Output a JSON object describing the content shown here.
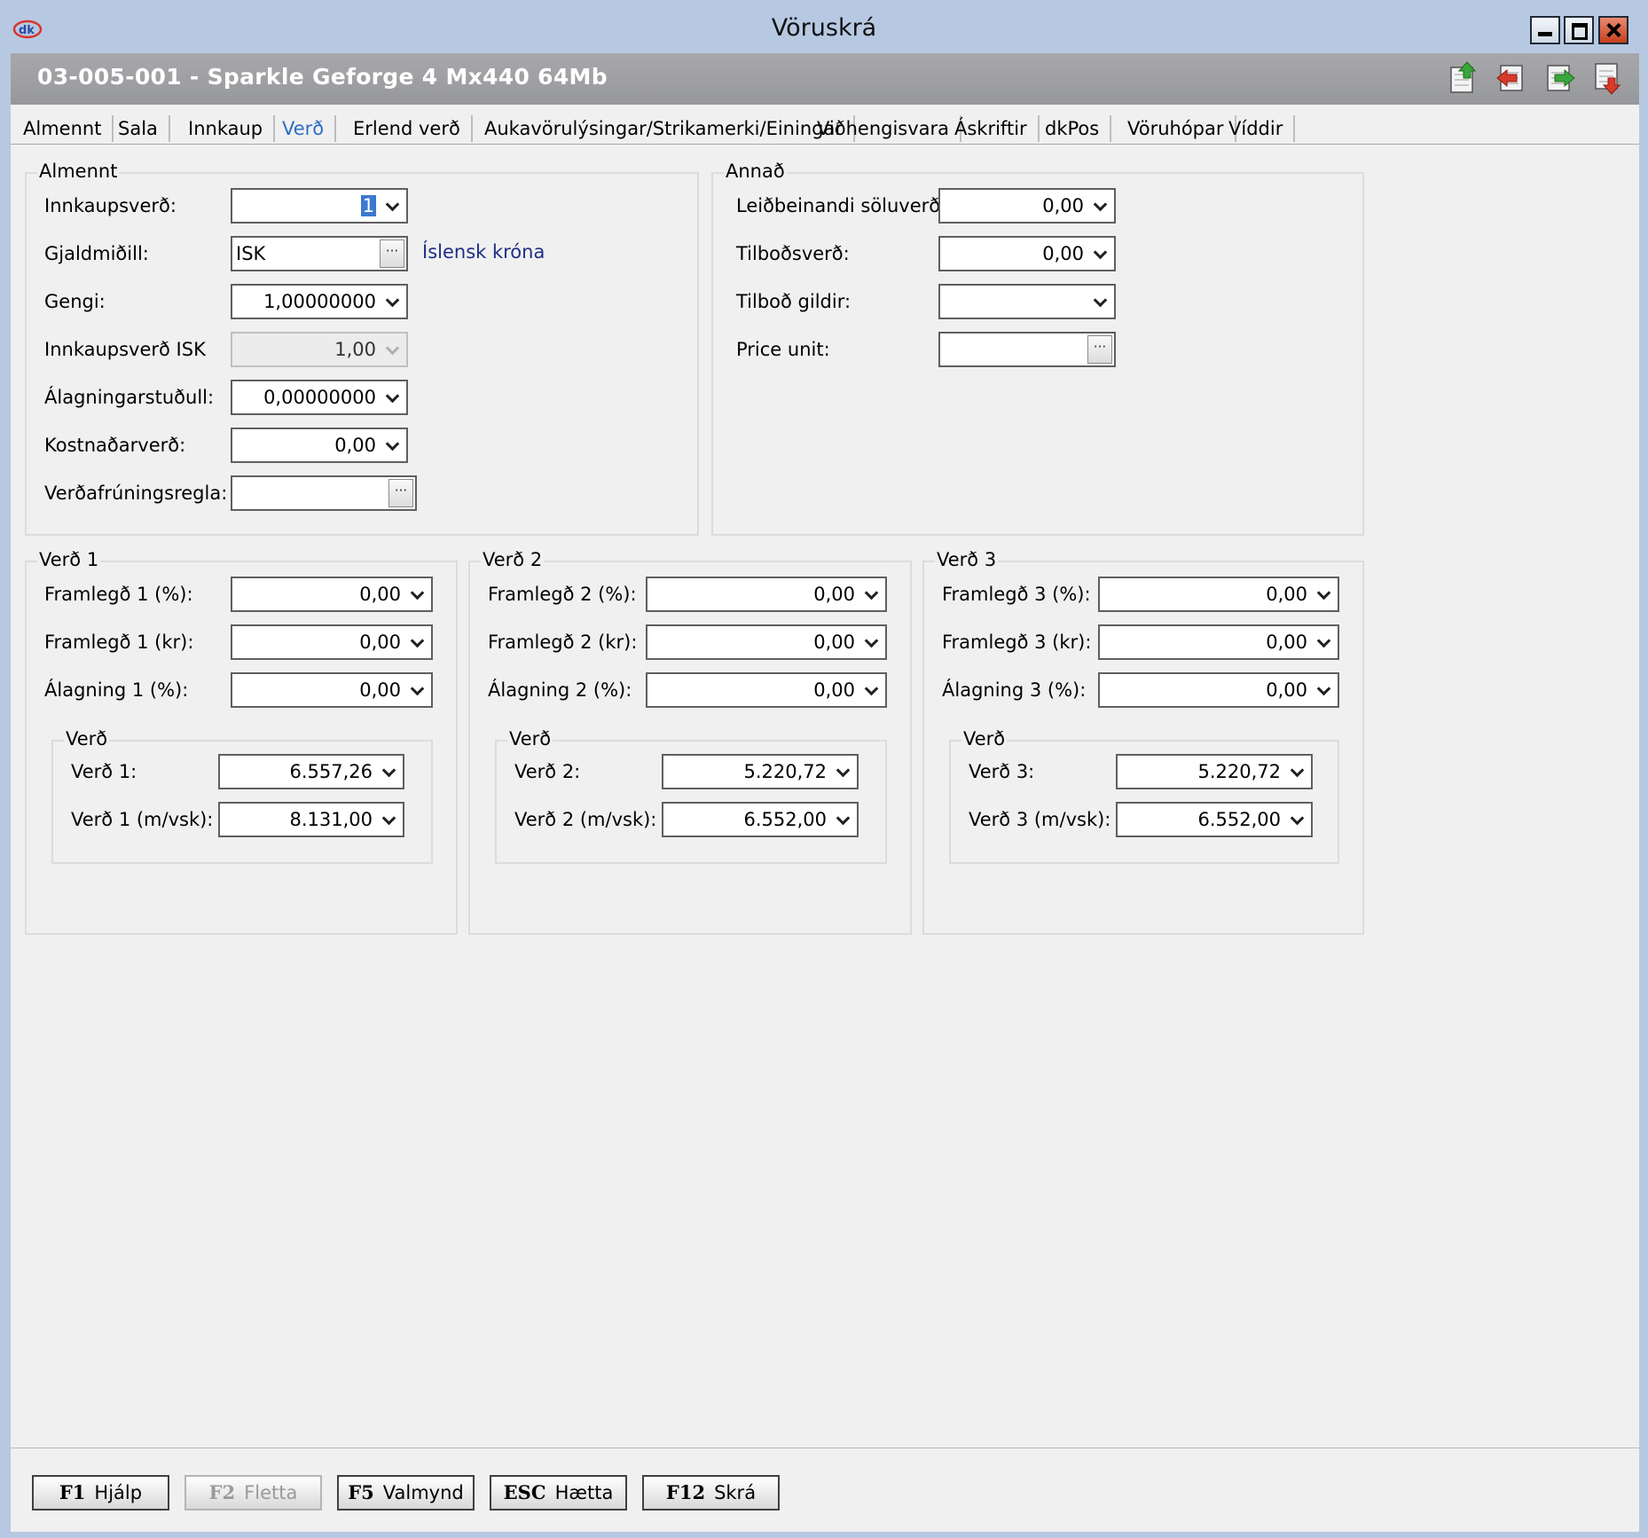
{
  "window": {
    "title": "Vöruskrá",
    "product_title": "03-005-001 - Sparkle Geforge 4 Mx440  64Mb"
  },
  "toolbar_icons": [
    "upload-record-icon",
    "previous-record-icon",
    "next-record-icon",
    "download-record-icon"
  ],
  "tabs": [
    "Almennt",
    "Sala",
    "Innkaup",
    "Verð",
    "Erlend verð",
    "Aukavörulýsingar/Strikamerki/Einingar",
    "Viðhengisvara",
    "Áskriftir",
    "dkPos",
    "Vöruhópar",
    "Víddir"
  ],
  "active_tab": "Verð",
  "almennt": {
    "title": "Almennt",
    "innkaupsverd": {
      "label": "Innkaupsverð:",
      "value": "1"
    },
    "gjaldmidill": {
      "label": "Gjaldmiðill:",
      "value": "ISK",
      "name": "Íslensk króna"
    },
    "gengi": {
      "label": "Gengi:",
      "value": "1,00000000"
    },
    "innkaupsverd_isk": {
      "label": "Innkaupsverð ISK",
      "value": "1,00"
    },
    "alagningarstudull": {
      "label": "Álagningarstuðull:",
      "value": "0,00000000"
    },
    "kostnadarverd": {
      "label": "Kostnaðarverð:",
      "value": "0,00"
    },
    "verdafruningsregla": {
      "label": "Verðafrúningsregla:",
      "value": ""
    }
  },
  "annad": {
    "title": "Annað",
    "leidbeinandi": {
      "label": "Leiðbeinandi söluverð:",
      "value": "0,00"
    },
    "tilbodsverd": {
      "label": "Tilboðsverð:",
      "value": "0,00"
    },
    "tilbod_gildir": {
      "label": "Tilboð gildir:",
      "value": ""
    },
    "price_unit": {
      "label": "Price unit:",
      "value": ""
    }
  },
  "prices": [
    {
      "title": "Verð 1",
      "framlegd_pct": {
        "label": "Framlegð 1 (%):",
        "value": "0,00"
      },
      "framlegd_kr": {
        "label": "Framlegð 1 (kr):",
        "value": "0,00"
      },
      "alagning_pct": {
        "label": "Álagning 1 (%):",
        "value": "0,00"
      },
      "sub_title": "Verð",
      "verd": {
        "label": "Verð 1:",
        "value": "6.557,26"
      },
      "verd_vsk": {
        "label": "Verð 1 (m/vsk):",
        "value": "8.131,00"
      }
    },
    {
      "title": "Verð 2",
      "framlegd_pct": {
        "label": "Framlegð 2 (%):",
        "value": "0,00"
      },
      "framlegd_kr": {
        "label": "Framlegð 2 (kr):",
        "value": "0,00"
      },
      "alagning_pct": {
        "label": "Álagning 2 (%):",
        "value": "0,00"
      },
      "sub_title": "Verð",
      "verd": {
        "label": "Verð 2:",
        "value": "5.220,72"
      },
      "verd_vsk": {
        "label": "Verð 2 (m/vsk):",
        "value": "6.552,00"
      }
    },
    {
      "title": "Verð 3",
      "framlegd_pct": {
        "label": "Framlegð 3 (%):",
        "value": "0,00"
      },
      "framlegd_kr": {
        "label": "Framlegð 3 (kr):",
        "value": "0,00"
      },
      "alagning_pct": {
        "label": "Álagning 3 (%):",
        "value": "0,00"
      },
      "sub_title": "Verð",
      "verd": {
        "label": "Verð 3:",
        "value": "5.220,72"
      },
      "verd_vsk": {
        "label": "Verð 3 (m/vsk):",
        "value": "6.552,00"
      }
    }
  ],
  "footer": {
    "help": {
      "key": "F1",
      "label": "Hjálp"
    },
    "browse": {
      "key": "F2",
      "label": "Fletta"
    },
    "menu": {
      "key": "F5",
      "label": "Valmynd"
    },
    "cancel": {
      "key": "ESC",
      "label": "Hætta"
    },
    "save": {
      "key": "F12",
      "label": "Skrá"
    }
  },
  "colors": {
    "titlebar": "#b7c9e2",
    "header": "#9fa0a3",
    "active_tab": "#2d6fc3",
    "link": "#1d2f85",
    "close": "#c63f1c"
  }
}
